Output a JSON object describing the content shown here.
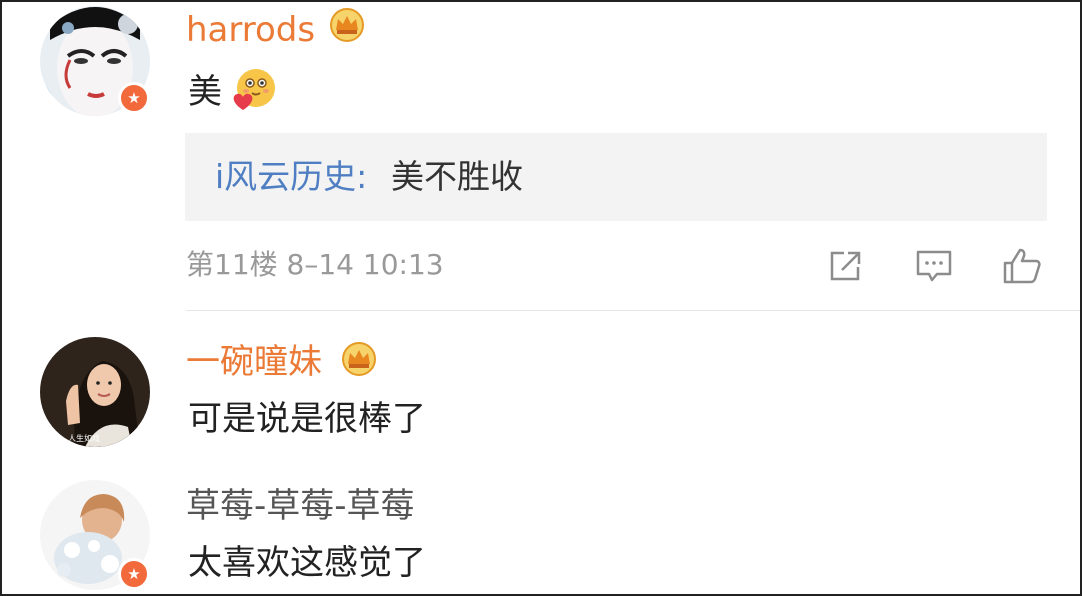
{
  "comments": [
    {
      "username": "harrods",
      "text": "美",
      "reply": {
        "author": "i风云历史:",
        "text": "美不胜收"
      },
      "floor": "第11楼",
      "date": "8–14",
      "time": "10:13"
    },
    {
      "username": "一碗曈妹",
      "text": "可是说是很棒了",
      "avatar_caption": "人生如戏 "
    },
    {
      "username": "草莓-草莓-草莓",
      "text": "太喜欢这感觉了"
    }
  ],
  "icons": {
    "verified_badge": "star-verified-icon",
    "vip": "crown-icon",
    "emoji": "heart-emoji-icon",
    "share": "share-icon",
    "comment": "comment-icon",
    "like": "thumbs-up-icon"
  },
  "colors": {
    "vip_name": "#ea7a36",
    "reply_author": "#4f7fc2",
    "badge": "#f26a3c",
    "meta": "#999999"
  }
}
